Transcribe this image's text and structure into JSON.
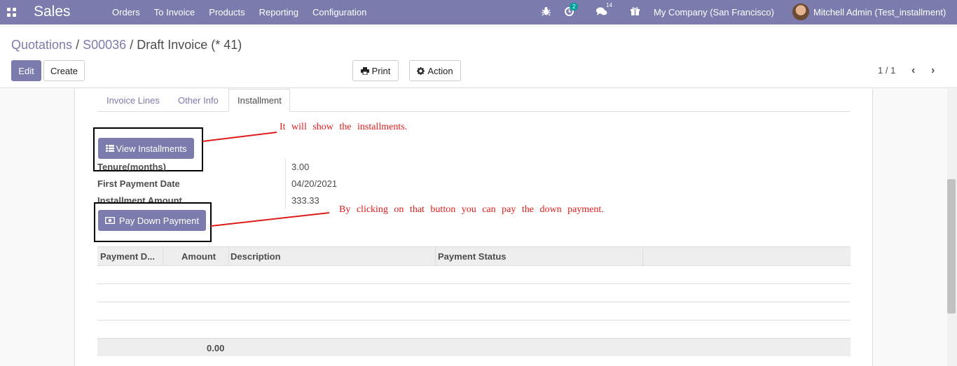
{
  "navbar": {
    "app_name": "Sales",
    "menu": [
      "Orders",
      "To Invoice",
      "Products",
      "Reporting",
      "Configuration"
    ],
    "activity_count": "2",
    "message_count": "14",
    "company": "My Company (San Francisco)",
    "user": "Mitchell Admin (Test_installment)"
  },
  "control_panel": {
    "breadcrumb": {
      "first": "Quotations",
      "sep": "/",
      "second": "S00036",
      "current": "Draft Invoice (* 41)"
    },
    "edit_label": "Edit",
    "create_label": "Create",
    "print_label": "Print",
    "action_label": "Action",
    "pager": "1 / 1"
  },
  "tabs": [
    "Invoice Lines",
    "Other Info",
    "Installment"
  ],
  "installment": {
    "view_installments_label": "View Installments",
    "pay_down_payment_label": "Pay Down Payment",
    "fields": [
      {
        "label": "Tenure(months)",
        "value": "3.00"
      },
      {
        "label": "First Payment Date",
        "value": "04/20/2021"
      },
      {
        "label": "Installment Amount",
        "value": "333.33"
      }
    ]
  },
  "annotations": {
    "view": "It will show the installments.",
    "pay": "By clicking on that button you can pay the down payment."
  },
  "table": {
    "headers": [
      "Payment D...",
      "Amount",
      "Description",
      "Payment Status"
    ],
    "total": "0.00"
  },
  "colors": {
    "brand": "#7c7bad",
    "annotation": "#e01b1b"
  },
  "icons": [
    "apps-icon",
    "bug-icon",
    "activity-icon",
    "chat-icon",
    "gift-icon",
    "print-icon",
    "gear-icon",
    "list-icon",
    "money-icon",
    "chevron-left-icon",
    "chevron-right-icon"
  ]
}
